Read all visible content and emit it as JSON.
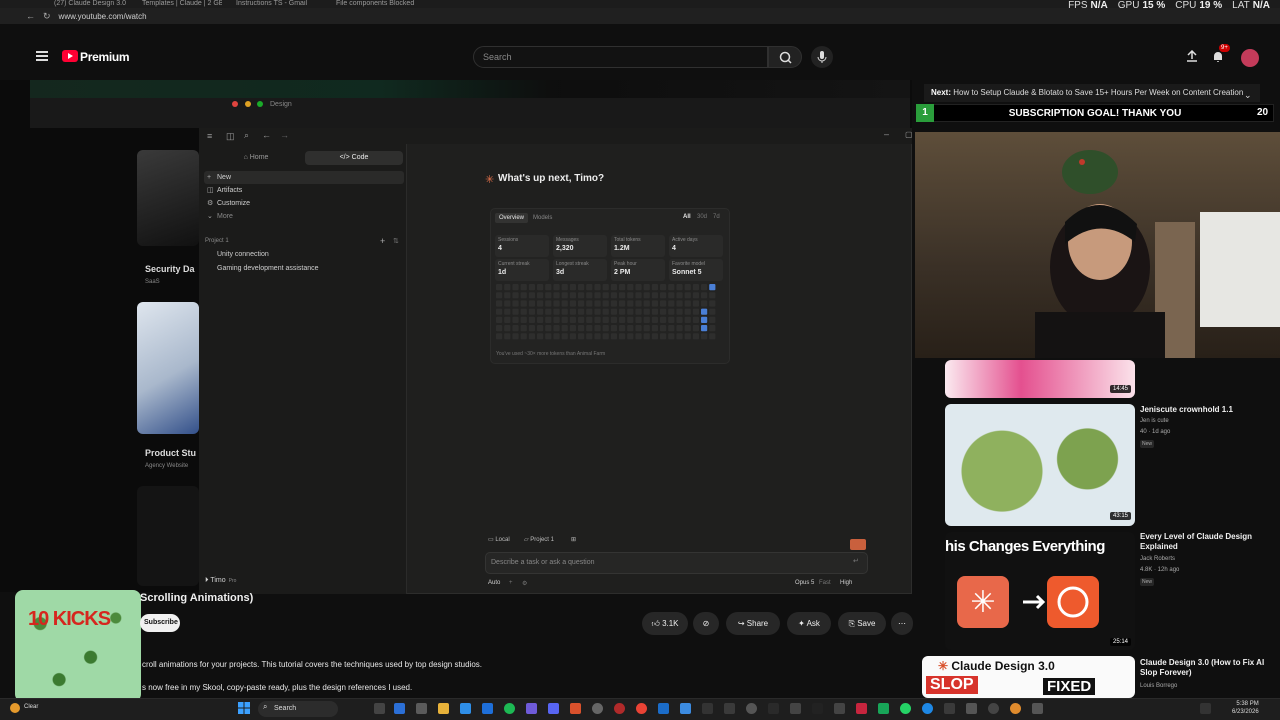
{
  "browser": {
    "tabs": [
      "(27) Claude Design 3.0",
      "Templates | Claude | 2 GB",
      "Instructions TS - Gmail",
      "File components Blocked"
    ],
    "url": "www.youtube.com/watch",
    "stats": [
      {
        "label": "FPS",
        "value": "N/A"
      },
      {
        "label": "GPU",
        "value": "15 %"
      },
      {
        "label": "CPU",
        "value": "19 %"
      },
      {
        "label": "LAT",
        "value": "N/A"
      }
    ]
  },
  "youtube": {
    "logo_label": "Premium",
    "search_placeholder": "Search",
    "notif_count": "9+",
    "video": {
      "title_suffix": "Scrolling Animations)",
      "subscribe": "Subscribe",
      "likes": "3.1K",
      "share": "Share",
      "ask": "Ask",
      "save": "Save",
      "desc_line_1": "croll animations for your projects. This tutorial covers the techniques used by top design studios.",
      "desc_line_2": "s now free in my Skool, copy-paste ready, plus the design references I used.",
      "overlay_text": "10 KICKS"
    },
    "up_next": {
      "prefix": "Next:",
      "title": "How to Setup Claude & Blotato to Save 15+ Hours Per Week on Content Creation"
    },
    "sub_goal": {
      "place": "1",
      "text": "SUBSCRIPTION GOAL! THANK YOU",
      "count": "20"
    },
    "related": [
      {
        "title": "",
        "channel": "",
        "meta": "",
        "duration": "14:45"
      },
      {
        "title": "Jeniscute crownhold 1.1",
        "channel": "Jen is cute",
        "meta": "40 · 1d ago",
        "badge": "New",
        "duration": "43:15"
      },
      {
        "title": "Every Level of Claude Design Explained",
        "channel": "Jack Roberts",
        "meta": "4.8K · 12h ago",
        "badge": "New",
        "duration": "25:14",
        "thumb_text": "his Changes Everything"
      },
      {
        "title": "Claude Design 3.0 (How to Fix AI Slop Forever)",
        "channel": "Louis Borrego",
        "meta": "",
        "thumb_text_1": "Claude Design 3.0",
        "thumb_text_2": "SLOP",
        "thumb_text_3": "FIXED"
      }
    ]
  },
  "behind_window": {
    "title": "Design",
    "card_1_title": "Security Da",
    "card_1_sub": "SaaS",
    "card_2_title": "Product Stu",
    "card_2_sub": "Agency Website"
  },
  "app": {
    "segments": [
      "Home",
      "Code"
    ],
    "nav": [
      {
        "icon": "+",
        "label": "New"
      },
      {
        "icon": "◫",
        "label": "Artifacts"
      },
      {
        "icon": "⚙",
        "label": "Customize"
      },
      {
        "icon": "⌄",
        "label": "More"
      }
    ],
    "project_header": "Project 1",
    "projects": [
      "Unity connection",
      "Gaming development assistance"
    ],
    "user": {
      "name": "Timo",
      "plan": "Pro"
    },
    "greeting": "What's up next, Timo?",
    "stats_tabs": [
      "Overview",
      "Models"
    ],
    "ranges": [
      "All",
      "30d",
      "7d"
    ],
    "stats": [
      {
        "label": "Sessions",
        "value": "4"
      },
      {
        "label": "Messages",
        "value": "2,320"
      },
      {
        "label": "Total tokens",
        "value": "1.2M"
      },
      {
        "label": "Active days",
        "value": "4"
      },
      {
        "label": "Current streak",
        "value": "1d"
      },
      {
        "label": "Longest streak",
        "value": "3d"
      },
      {
        "label": "Peak hour",
        "value": "2 PM"
      },
      {
        "label": "Favorite model",
        "value": "Sonnet 5"
      }
    ],
    "heat_note": "You've used ~30× more tokens than Animal Farm",
    "chips": [
      "Local",
      "Project 1"
    ],
    "composer_placeholder": "Describe a task or ask a question",
    "options": {
      "mode": "Auto",
      "model": "Opus 5",
      "speed": "Fast",
      "effort": "High"
    }
  },
  "taskbar": {
    "search": "Search",
    "time": "5:38 PM",
    "date": "6/23/2026",
    "weather": "Clear",
    "accent": "#0078d4"
  }
}
